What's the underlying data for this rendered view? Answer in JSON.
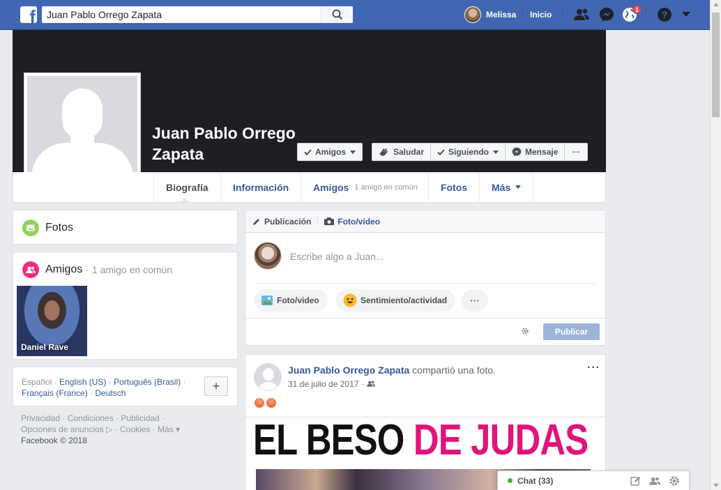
{
  "topbar": {
    "logo": "f",
    "search_value": "Juan Pablo Orrego Zapata",
    "user_name": "Melissa",
    "home_label": "Inicio",
    "notifications_badge": "1",
    "icons": [
      "friend-requests-icon",
      "messenger-icon",
      "notifications-globe-icon",
      "help-icon",
      "account-menu-caret-icon"
    ]
  },
  "profile": {
    "name": "Juan Pablo Orrego Zapata",
    "buttons": {
      "friends": "Amigos",
      "wave": "Saludar",
      "following": "Siguiendo",
      "message": "Mensaje",
      "more": "···"
    }
  },
  "tabs": [
    {
      "label": "Biografía"
    },
    {
      "label": "Información"
    },
    {
      "label": "Amigos",
      "sub": "1 amigo en común"
    },
    {
      "label": "Fotos"
    },
    {
      "label": "Más"
    }
  ],
  "left": {
    "photos_title": "Fotos",
    "friends_title": "Amigos",
    "friends_sub": "· 1 amigo en común",
    "friend_name": "Daniel Rave",
    "languages": {
      "line1": [
        "Español",
        "English (US)",
        "Português (Brasil)"
      ],
      "line2": [
        "Français (France)",
        "Deutsch"
      ],
      "add": "+"
    },
    "footer": {
      "line1": "Privacidad · Condiciones · Publicidad ·",
      "line2": "Opciones de anuncios ▷ · Cookies · Más ▾",
      "line3": "Facebook © 2018"
    }
  },
  "composer": {
    "tab_post": "Publicación",
    "tab_photo": "Foto/video",
    "placeholder": "Escribe algo a Juan...",
    "pill_photo": "Foto/video",
    "pill_feeling": "Sentimiento/actividad",
    "pill_more": "···",
    "publish": "Publicar"
  },
  "post": {
    "author": "Juan Pablo Orrego Zapata",
    "action": "compartió una foto.",
    "date": "31 de julio de 2017",
    "more": "···",
    "headline_black": "EL BESO",
    "headline_pink": "DE JUDAS"
  },
  "chat": {
    "label": "Chat (33)"
  },
  "colors": {
    "brand": "#4267b2",
    "link": "#365899",
    "headline_pink": "#e0147a"
  }
}
